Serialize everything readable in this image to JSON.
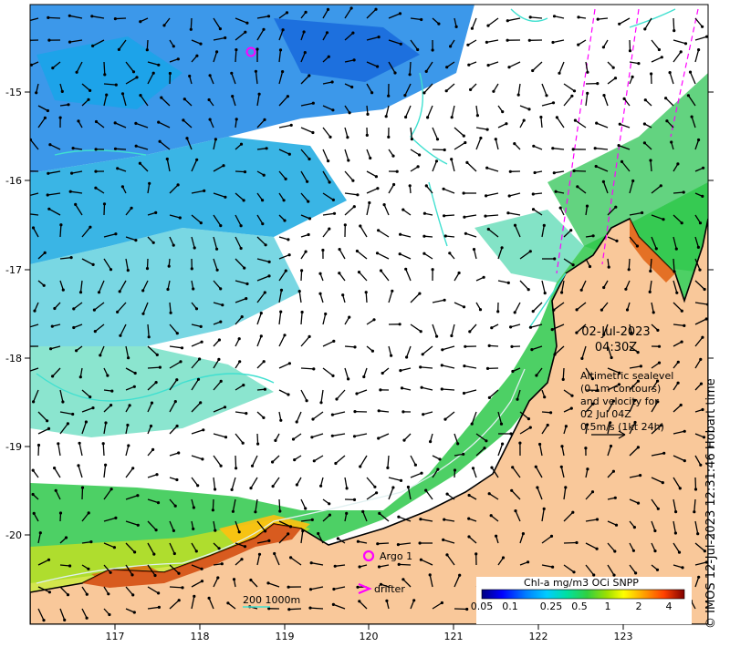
{
  "map": {
    "lon_ticks": [
      "117",
      "118",
      "119",
      "120",
      "121",
      "122",
      "123"
    ],
    "lat_ticks": [
      "-15",
      "-16",
      "-17",
      "-18",
      "-19",
      "-20"
    ],
    "datetime_line1": "02-Jul-2023",
    "datetime_line2": "04:30Z",
    "info_lines": [
      "Altimetric sealevel",
      "(0.1m contours)",
      "and velocity for",
      "02 Jul 04Z",
      "0.5m/s (1kt 24h)"
    ],
    "argo_label": "Argo 1",
    "drifter_label": "drifter",
    "scale_label": "200  1000m",
    "colorbar": {
      "title": "Chl-a mg/m3 OCi SNPP",
      "ticks": [
        "0.05",
        "0.1",
        "0.25",
        "0.5",
        "1",
        "2",
        "4"
      ],
      "colors": [
        "#00007f",
        "#0000ff",
        "#0080ff",
        "#00ccff",
        "#00e0a0",
        "#30d040",
        "#a0e000",
        "#ffff00",
        "#ffa000",
        "#ff4000",
        "#c00000",
        "#800000"
      ]
    },
    "credit": "© IMOS 12-Jul-2023 12:31:46 Hobart time",
    "colors": {
      "land": "#f9c89a",
      "coastline": "#000000",
      "contour": "#40e0d0",
      "track": "#ff00ff"
    }
  }
}
